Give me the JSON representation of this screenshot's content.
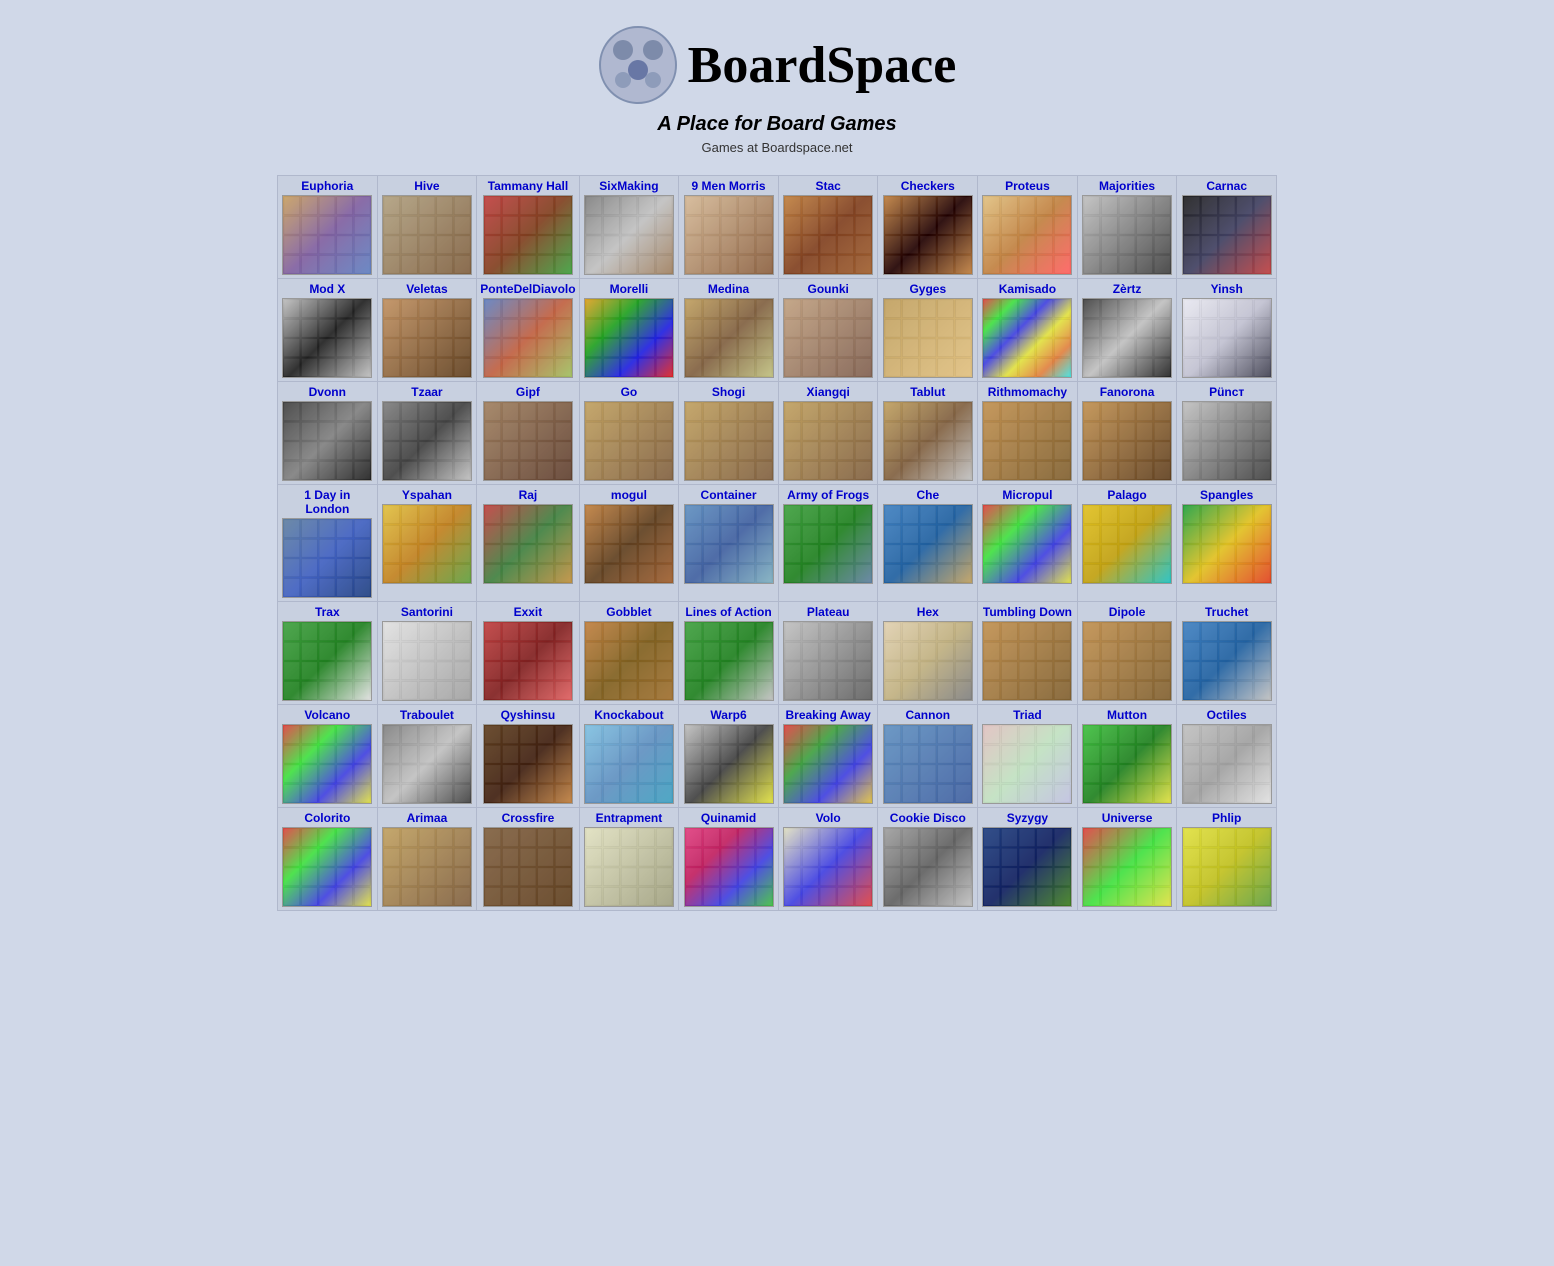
{
  "site": {
    "title": "BoardSpace",
    "tagline": "A Place for Board Games",
    "subtitle": "Games at Boardspace.net"
  },
  "rows": [
    [
      {
        "name": "Euphoria",
        "class": "g-euphoria"
      },
      {
        "name": "Hive",
        "class": "g-hive"
      },
      {
        "name": "Tammany Hall",
        "class": "g-tammany"
      },
      {
        "name": "SixMaking",
        "class": "g-sixmaking"
      },
      {
        "name": "9 Men Morris",
        "class": "g-9men"
      },
      {
        "name": "Stac",
        "class": "g-stac"
      },
      {
        "name": "Checkers",
        "class": "g-checkers"
      },
      {
        "name": "Proteus",
        "class": "g-proteus"
      },
      {
        "name": "Majorities",
        "class": "g-majorities"
      },
      {
        "name": "Carnac",
        "class": "g-carnac"
      }
    ],
    [
      {
        "name": "Mod X",
        "class": "g-modx"
      },
      {
        "name": "Veletas",
        "class": "g-veletas"
      },
      {
        "name": "PonteDelDiavolo",
        "class": "g-pontedel"
      },
      {
        "name": "Morelli",
        "class": "g-morelli"
      },
      {
        "name": "Medina",
        "class": "g-medina"
      },
      {
        "name": "Gounki",
        "class": "g-gounki"
      },
      {
        "name": "Gyges",
        "class": "g-gyges"
      },
      {
        "name": "Kamisado",
        "class": "g-kamisado"
      },
      {
        "name": "Zèrtz",
        "class": "g-zertz"
      },
      {
        "name": "Yinsh",
        "class": "g-yinsh"
      }
    ],
    [
      {
        "name": "Dvonn",
        "class": "g-dvonn"
      },
      {
        "name": "Tzaar",
        "class": "g-tzaar"
      },
      {
        "name": "Gipf",
        "class": "g-gipf"
      },
      {
        "name": "Go",
        "class": "g-go"
      },
      {
        "name": "Shogi",
        "class": "g-shogi"
      },
      {
        "name": "Xiangqi",
        "class": "g-xiangqi"
      },
      {
        "name": "Tablut",
        "class": "g-tablut"
      },
      {
        "name": "Rithmomachy",
        "class": "g-rithmo"
      },
      {
        "name": "Fanorona",
        "class": "g-fanorona"
      },
      {
        "name": "Püncт",
        "class": "g-punct"
      }
    ],
    [
      {
        "name": "1 Day in London",
        "class": "g-1day"
      },
      {
        "name": "Yspahan",
        "class": "g-yspahan"
      },
      {
        "name": "Raj",
        "class": "g-raj"
      },
      {
        "name": "mogul",
        "class": "g-mogul"
      },
      {
        "name": "Container",
        "class": "g-container"
      },
      {
        "name": "Army of Frogs",
        "class": "g-armyfrogs"
      },
      {
        "name": "Che",
        "class": "g-che"
      },
      {
        "name": "Micropul",
        "class": "g-micropul"
      },
      {
        "name": "Palago",
        "class": "g-palago"
      },
      {
        "name": "Spangles",
        "class": "g-spangles"
      }
    ],
    [
      {
        "name": "Trax",
        "class": "g-trax"
      },
      {
        "name": "Santorini",
        "class": "g-santorini"
      },
      {
        "name": "Exxit",
        "class": "g-exxit"
      },
      {
        "name": "Gobblet",
        "class": "g-gobblet"
      },
      {
        "name": "Lines of Action",
        "class": "g-linesofaction"
      },
      {
        "name": "Plateau",
        "class": "g-plateau"
      },
      {
        "name": "Hex",
        "class": "g-hex"
      },
      {
        "name": "Tumbling Down",
        "class": "g-tumbling"
      },
      {
        "name": "Dipole",
        "class": "g-dipole"
      },
      {
        "name": "Truchet",
        "class": "g-truchet"
      }
    ],
    [
      {
        "name": "Volcano",
        "class": "g-volcano"
      },
      {
        "name": "Traboulet",
        "class": "g-traboulet"
      },
      {
        "name": "Qyshinsu",
        "class": "g-qyshinsu"
      },
      {
        "name": "Knockabout",
        "class": "g-knockabout"
      },
      {
        "name": "Warp6",
        "class": "g-warp6"
      },
      {
        "name": "Breaking Away",
        "class": "g-breaking"
      },
      {
        "name": "Cannon",
        "class": "g-cannon"
      },
      {
        "name": "Triad",
        "class": "g-triad"
      },
      {
        "name": "Mutton",
        "class": "g-mutton"
      },
      {
        "name": "Octiles",
        "class": "g-octiles"
      }
    ],
    [
      {
        "name": "Colorito",
        "class": "g-colorito"
      },
      {
        "name": "Arimaa",
        "class": "g-arimaa"
      },
      {
        "name": "Crossfire",
        "class": "g-crossfire"
      },
      {
        "name": "Entrapment",
        "class": "g-entrapment"
      },
      {
        "name": "Quinamid",
        "class": "g-quinamid"
      },
      {
        "name": "Volo",
        "class": "g-volo"
      },
      {
        "name": "Cookie Disco",
        "class": "g-cookiedisco"
      },
      {
        "name": "Syzygy",
        "class": "g-syzygy"
      },
      {
        "name": "Universe",
        "class": "g-universe"
      },
      {
        "name": "Phlip",
        "class": "g-phlip"
      }
    ]
  ]
}
